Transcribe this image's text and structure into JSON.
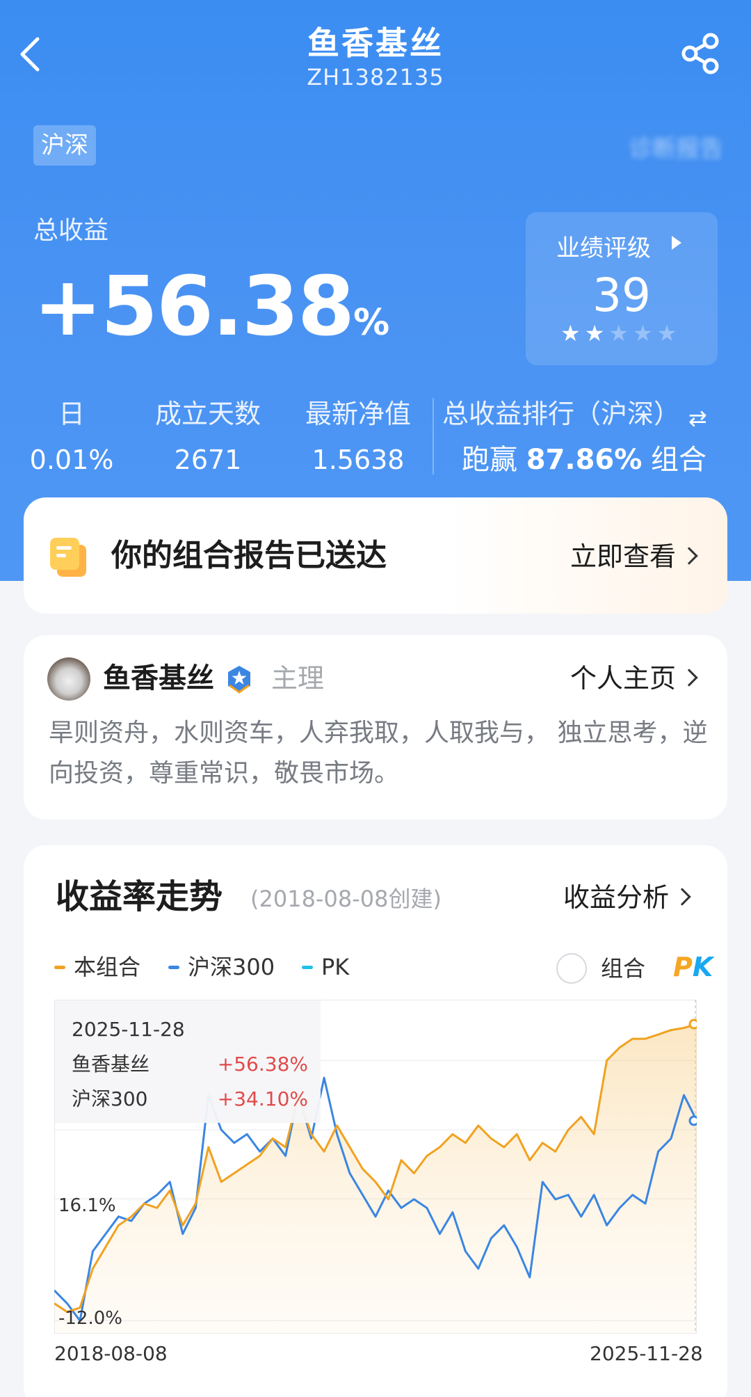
{
  "header": {
    "title": "鱼香基丝",
    "code": "ZH1382135",
    "market_tag": "沪深",
    "blurred_text": "诊断报告"
  },
  "summary": {
    "total_label": "总收益",
    "total_value": "+56.38",
    "total_unit": "%",
    "rating_label": "业绩评级",
    "rating_score": "39",
    "rating_stars": 2,
    "rating_stars_max": 5
  },
  "stats": [
    {
      "label": "日",
      "value": "0.01%"
    },
    {
      "label": "成立天数",
      "value": "2671"
    },
    {
      "label": "最新净值",
      "value": "1.5638"
    }
  ],
  "rank": {
    "label": "总收益排行（沪深）",
    "prefix": "跑赢",
    "value": "87.86%",
    "suffix": "组合"
  },
  "report": {
    "title": "你的组合报告已送达",
    "action": "立即查看"
  },
  "profile": {
    "name": "鱼香基丝",
    "role": "主理",
    "homepage": "个人主页",
    "bio": "旱则资舟，水则资车，人弃我取，人取我与， 独立思考，逆向投资，尊重常识，敬畏市场。"
  },
  "chart_section": {
    "title": "收益率走势",
    "created": "(2018-08-08创建)",
    "analysis": "收益分析",
    "legend": [
      {
        "name": "本组合",
        "color": "#f0a221"
      },
      {
        "name": "沪深300",
        "color": "#3a86e2"
      },
      {
        "name": "PK",
        "color": "#20c0e8"
      }
    ],
    "pk_label": "组合",
    "pk_logo_p": "P",
    "pk_logo_k": "K",
    "tooltip": {
      "date": "2025-11-28",
      "rows": [
        {
          "name": "鱼香基丝",
          "value": "+56.38%"
        },
        {
          "name": "沪深300",
          "value": "+34.10%"
        }
      ]
    }
  },
  "chart_data": {
    "type": "line",
    "x_start": "2018-08-08",
    "x_end": "2025-11-28",
    "y_tick_labels": [
      "16.1%",
      "-12.0%"
    ],
    "y_ticks": [
      16.1,
      -12.0
    ],
    "ylim": [
      -15,
      62
    ],
    "x": [
      0,
      0.02,
      0.04,
      0.06,
      0.08,
      0.1,
      0.12,
      0.14,
      0.16,
      0.18,
      0.2,
      0.22,
      0.24,
      0.26,
      0.28,
      0.3,
      0.32,
      0.34,
      0.36,
      0.38,
      0.4,
      0.42,
      0.44,
      0.46,
      0.48,
      0.5,
      0.52,
      0.54,
      0.56,
      0.58,
      0.6,
      0.62,
      0.64,
      0.66,
      0.68,
      0.7,
      0.72,
      0.74,
      0.76,
      0.78,
      0.8,
      0.82,
      0.84,
      0.86,
      0.88,
      0.9,
      0.92,
      0.94,
      0.96,
      0.98,
      1.0
    ],
    "series": [
      {
        "name": "本组合",
        "color": "#f0a221",
        "values": [
          -8,
          -10,
          -9,
          0,
          5,
          10,
          12,
          15,
          14,
          18,
          10,
          15,
          28,
          20,
          22,
          24,
          26,
          30,
          28,
          40,
          31,
          27,
          33,
          28,
          23,
          20,
          16,
          25,
          22,
          26,
          28,
          31,
          29,
          33,
          30,
          28,
          31,
          25,
          29,
          27,
          32,
          35,
          31,
          48,
          51,
          53,
          53,
          54,
          55,
          55.5,
          56.38
        ]
      },
      {
        "name": "沪深300",
        "color": "#3a86e2",
        "values": [
          -5,
          -8,
          -12,
          4,
          8,
          12,
          11,
          15,
          17,
          20,
          8,
          14,
          40,
          32,
          29,
          31,
          27,
          30,
          26,
          40,
          30,
          44,
          31,
          22,
          17,
          12,
          18,
          14,
          16,
          14,
          8,
          13,
          4,
          0,
          7,
          10,
          5,
          -2,
          20,
          16,
          17,
          12,
          17,
          10,
          14,
          17,
          15,
          27,
          30,
          40,
          34.1
        ]
      }
    ],
    "grid": "horizontal"
  }
}
